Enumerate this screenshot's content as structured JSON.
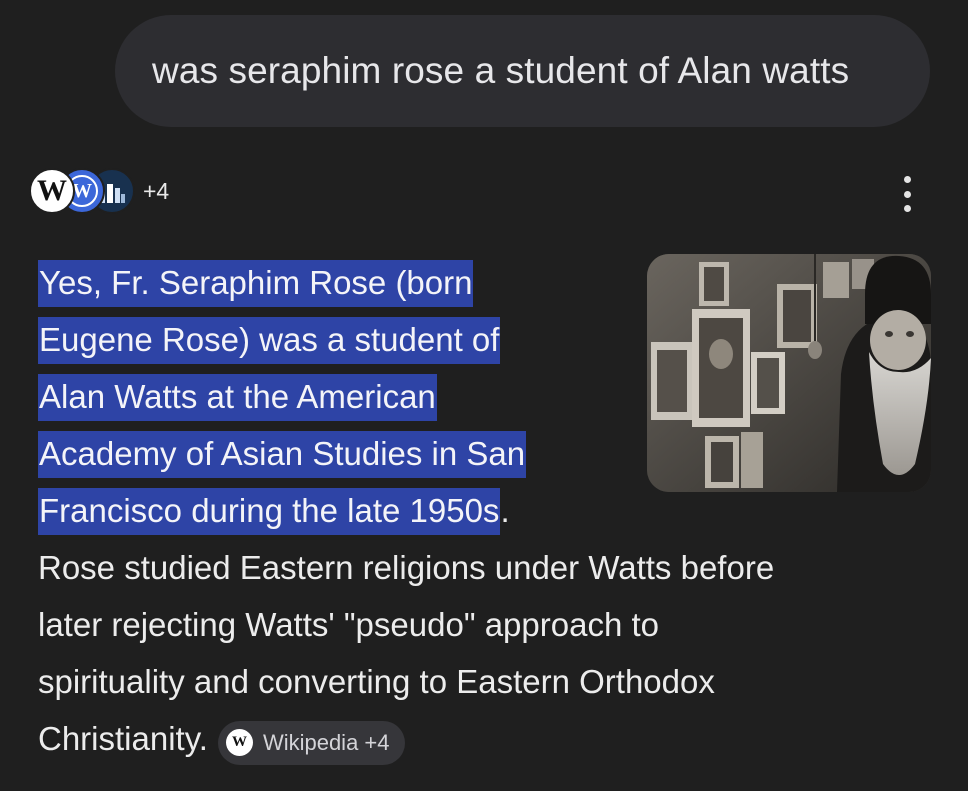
{
  "query": {
    "text": "was seraphim rose a student of Alan watts"
  },
  "sources": {
    "icons": [
      "wikipedia-icon",
      "wordpress-icon",
      "building-icon"
    ],
    "wiki_glyph": "W",
    "wp_glyph": "W",
    "more_count": "+4"
  },
  "answer": {
    "highlighted_lines": [
      "Yes, Fr. Seraphim Rose (born",
      "Eugene Rose) was a student of",
      "Alan Watts at the American",
      "Academy of Asian Studies in San",
      "Francisco during the late 1950s"
    ],
    "highlight_end_punct": ".",
    "body_lines": [
      "Rose studied Eastern religions under Watts before",
      "later rejecting Watts' \"pseudo\" approach to",
      "spirituality and converting to Eastern Orthodox",
      "Christianity."
    ]
  },
  "citation_chip": {
    "icon_glyph": "W",
    "label": "Wikipedia +4"
  },
  "colors": {
    "background": "#1f1f1f",
    "query_bubble": "#2d2d31",
    "highlight": "#2e44a6",
    "chip_bg": "#36363a"
  }
}
